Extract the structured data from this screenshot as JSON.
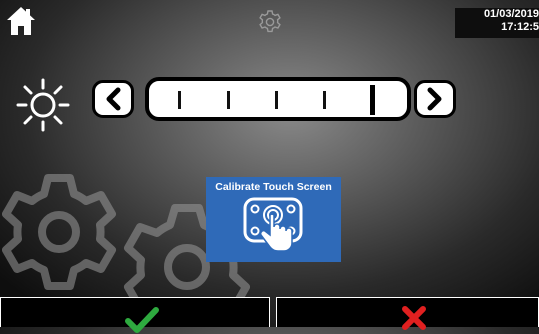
{
  "header": {
    "home_icon": "home-icon",
    "settings_icon": "gear-icon",
    "date": "01/03/2019",
    "time": "17:12:5"
  },
  "brightness": {
    "icon": "sun-icon",
    "decrease_icon": "chevron-left-icon",
    "increase_icon": "chevron-right-icon",
    "level": 5,
    "levels": 5
  },
  "calibrate": {
    "label": "Calibrate Touch Screen",
    "icon": "touch-screen-icon",
    "color": "#2f6ab8"
  },
  "footer": {
    "confirm_icon": "checkmark-icon",
    "confirm_color": "#2eaa3f",
    "cancel_icon": "cross-icon",
    "cancel_color": "#e02020"
  }
}
